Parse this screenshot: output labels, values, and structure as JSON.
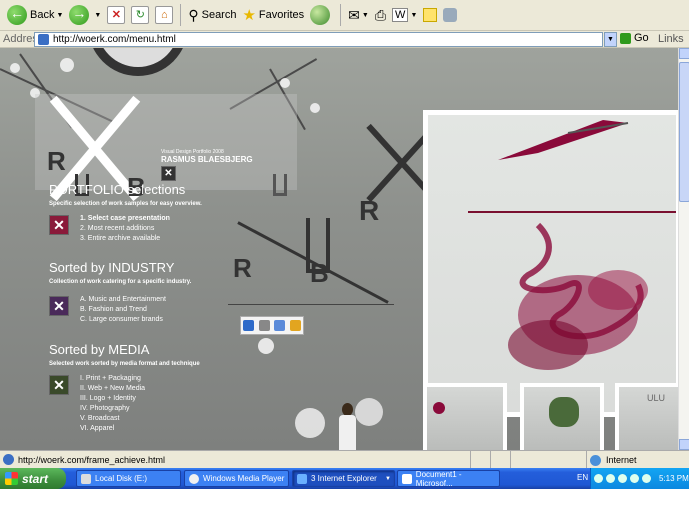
{
  "toolbar": {
    "back_label": "Back",
    "search_label": "Search",
    "favorites_label": "Favorites"
  },
  "address_bar": {
    "label": "Address",
    "url": "http://woerk.com/menu.html",
    "go_label": "Go",
    "links_label": "Links"
  },
  "page": {
    "header_subtitle": "Visual Design Portfolio 2008",
    "header_title": "RASMUS BLAESBJERG",
    "logo_letters": [
      "R",
      "B"
    ],
    "sections": [
      {
        "title_pre": "PORTFOLIO",
        "title_post": " selections",
        "desc": "Specific selection of work samples for easy overview.",
        "items": [
          "1. Select case presentation",
          "2. Most recent additions",
          "3. Entire archive available"
        ]
      },
      {
        "title_pre": "Sorted by ",
        "title_post": "INDUSTRY",
        "desc": "Collection of work catering for a specific industry.",
        "items": [
          "A. Music and Entertainment",
          "B. Fashion and Trend",
          "C. Large consumer brands"
        ]
      },
      {
        "title_pre": "Sorted by ",
        "title_post": "MEDIA",
        "desc": "Selected work sorted by media format and technique",
        "items": [
          "I. Print + Packaging",
          "II. Web + New Media",
          "III. Logo + Identity",
          "IV. Photography",
          "V. Broadcast",
          "VI. Apparel"
        ]
      }
    ],
    "section_colors": [
      "#8a1a3a",
      "#4a2a5a",
      "#3a4a2a"
    ],
    "thumb_text": "ULU"
  },
  "status_bar": {
    "text": "http://woerk.com/frame_achieve.html",
    "zone": "Internet"
  },
  "taskbar": {
    "start_label": "start",
    "tasks": [
      "Local Disk (E:)",
      "Windows Media Player",
      "3 Internet Explorer",
      "Document1 - Microsof..."
    ],
    "language": "EN",
    "clock": "5:13 PM"
  }
}
